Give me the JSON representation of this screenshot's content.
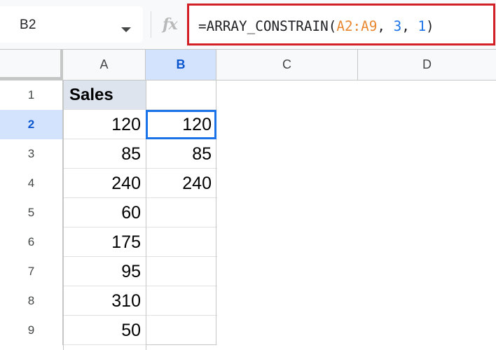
{
  "name_box": {
    "ref": "B2"
  },
  "formula_bar": {
    "fx_label": "fx",
    "tokens": [
      {
        "text": "=ARRAY_CONSTRAIN(",
        "kind": "plain"
      },
      {
        "text": "A2:A9",
        "kind": "range"
      },
      {
        "text": ", ",
        "kind": "plain"
      },
      {
        "text": "3",
        "kind": "num"
      },
      {
        "text": ", ",
        "kind": "plain"
      },
      {
        "text": "1",
        "kind": "num"
      },
      {
        "text": ")",
        "kind": "plain"
      }
    ]
  },
  "columns": [
    "A",
    "B",
    "C",
    "D"
  ],
  "selected_column": "B",
  "rows": [
    {
      "num": "1",
      "a": "Sales",
      "b": ""
    },
    {
      "num": "2",
      "a": "120",
      "b": "120"
    },
    {
      "num": "3",
      "a": "85",
      "b": "85"
    },
    {
      "num": "4",
      "a": "240",
      "b": "240"
    },
    {
      "num": "5",
      "a": "60",
      "b": ""
    },
    {
      "num": "6",
      "a": "175",
      "b": ""
    },
    {
      "num": "7",
      "a": "95",
      "b": ""
    },
    {
      "num": "8",
      "a": "310",
      "b": ""
    },
    {
      "num": "9",
      "a": "50",
      "b": ""
    }
  ],
  "selected_row": "2",
  "colors": {
    "highlight_border": "#d32027",
    "selection": "#1a73e8",
    "header_fill": "#dde4ee"
  }
}
